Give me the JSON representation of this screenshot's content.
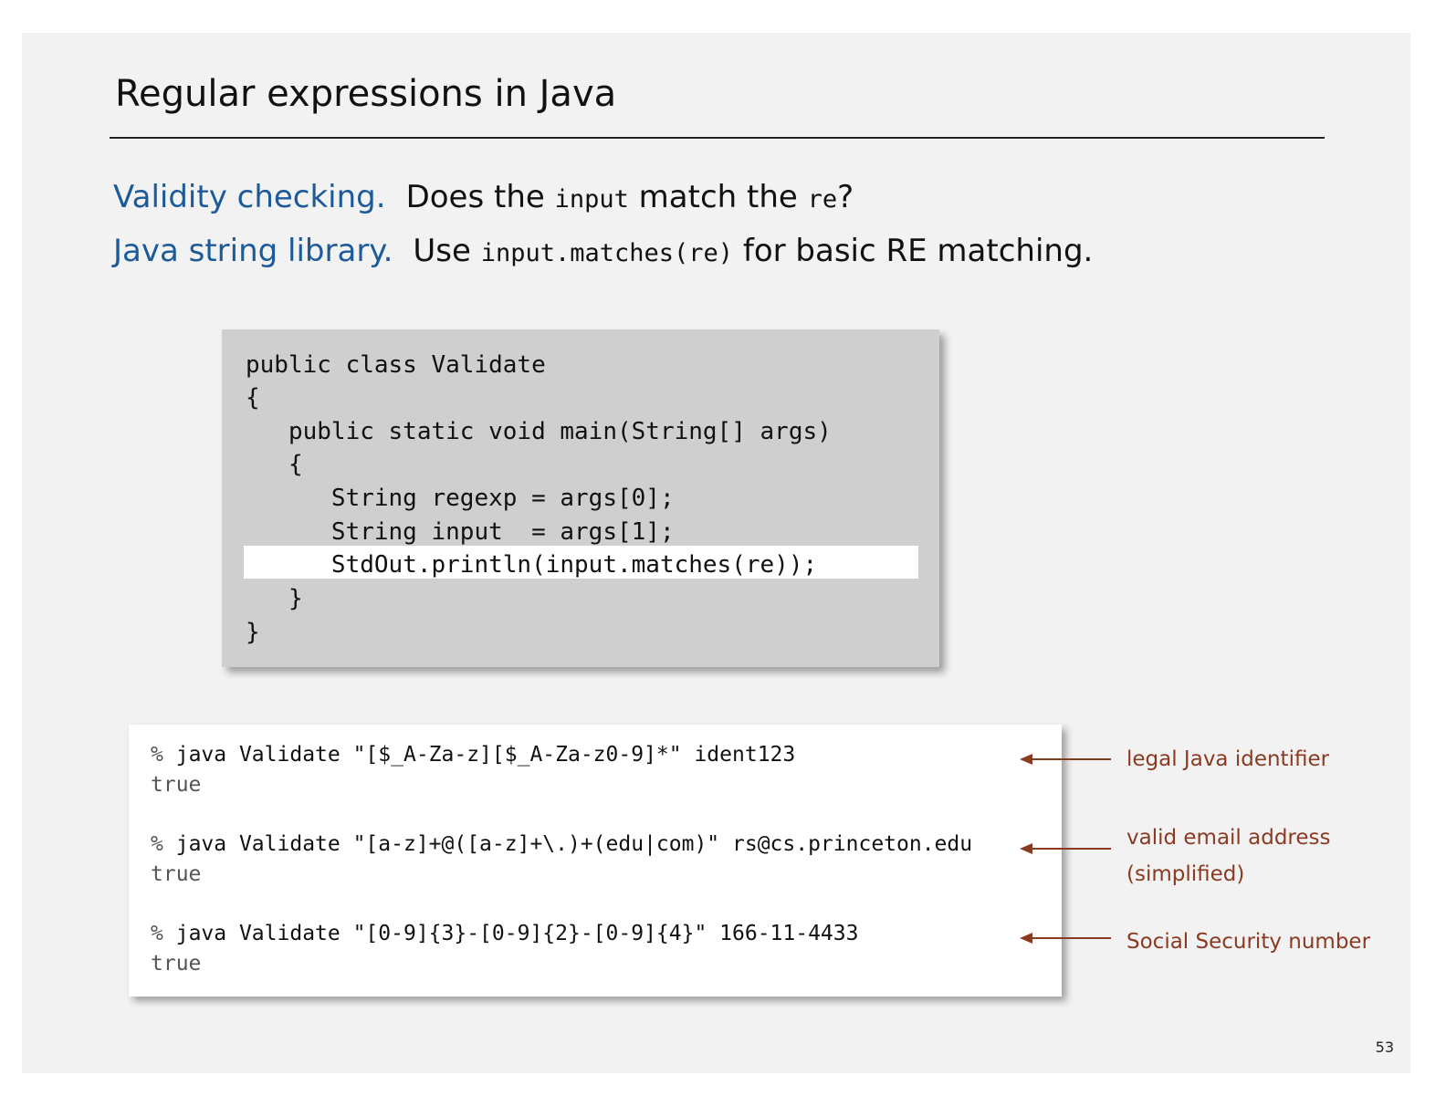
{
  "title": "Regular expressions in Java",
  "bullets": [
    {
      "term": "Validity checking.",
      "parts": [
        "Does the ",
        "input",
        " match the ",
        "re",
        "?"
      ]
    },
    {
      "term": "Java string library.",
      "parts": [
        "Use ",
        "input.matches(re)",
        " for basic RE matching."
      ]
    }
  ],
  "code": [
    "public class Validate",
    "{",
    "   public static void main(String[] args)",
    "   {",
    "      String regexp = args[0];",
    "      String input  = args[1];",
    "      StdOut.println(input.matches(re));",
    "   }",
    "}"
  ],
  "terminal": [
    {
      "prompt": "%",
      "command": "java Validate \"[$_A-Za-z][$_A-Za-z0-9]*\" ident123",
      "output": "true",
      "note": [
        "legal Java identifier"
      ]
    },
    {
      "prompt": "%",
      "command": "java Validate \"[a-z]+@([a-z]+\\.)+(edu|com)\" rs@cs.princeton.edu",
      "output": "true",
      "note": [
        "valid email address",
        "(simplified)"
      ]
    },
    {
      "prompt": "%",
      "command": "java Validate \"[0-9]{3}-[0-9]{2}-[0-9]{4}\" 166-11-4433",
      "output": "true",
      "note": [
        "Social Security number"
      ]
    }
  ],
  "page_number": "53",
  "colors": {
    "term_blue": "#1d5a9a",
    "note_red": "#8b3a22",
    "slide_bg": "#f2f2f2"
  }
}
